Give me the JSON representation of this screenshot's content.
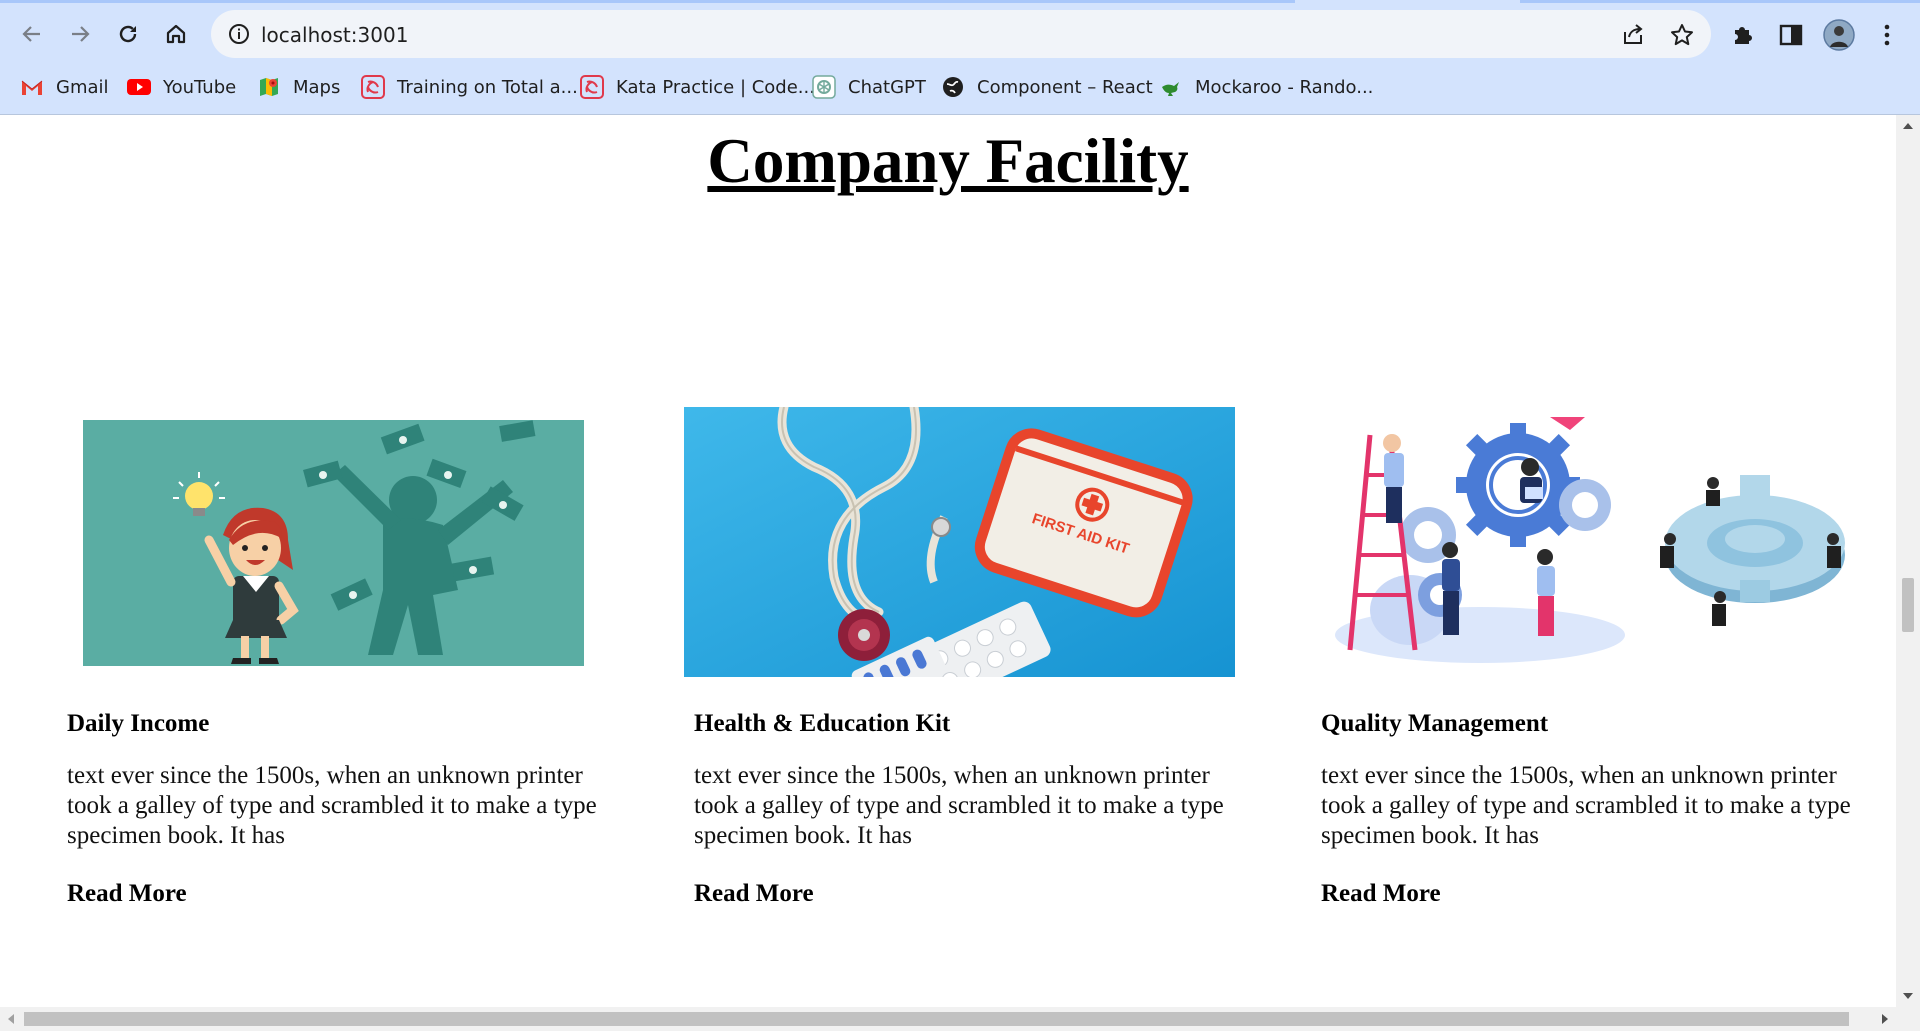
{
  "browser": {
    "url": "localhost:3001",
    "bookmarks": [
      {
        "label": "Gmail",
        "icon": "gmail-icon"
      },
      {
        "label": "YouTube",
        "icon": "youtube-icon"
      },
      {
        "label": "Maps",
        "icon": "maps-icon"
      },
      {
        "label": "Training on Total a...",
        "icon": "swirl-icon"
      },
      {
        "label": "Kata Practice | Code...",
        "icon": "swirl-icon"
      },
      {
        "label": "ChatGPT",
        "icon": "chatgpt-icon"
      },
      {
        "label": "Component – React",
        "icon": "globe-icon"
      },
      {
        "label": "Mockaroo - Rando...",
        "icon": "kangaroo-icon"
      }
    ]
  },
  "page": {
    "title": "Company Facility",
    "cards": [
      {
        "title": "Daily Income",
        "text": "text ever since the 1500s, when an unknown printer took a galley of type and scrambled it to make a type specimen book. It has",
        "link": "Read More",
        "image": "daily-income-illustration"
      },
      {
        "title": "Health & Education Kit",
        "text": "text ever since the 1500s, when an unknown printer took a galley of type and scrambled it to make a type specimen book. It has",
        "link": "Read More",
        "image": "first-aid-kit-photo",
        "image_caption": "FIRST AID KIT"
      },
      {
        "title": "Quality Management",
        "text": "text ever since the 1500s, when an unknown printer took a galley of type and scrambled it to make a type specimen book. It has",
        "link": "Read More",
        "image": "gears-team-illustration"
      }
    ]
  },
  "colors": {
    "chrome": "#d3e3fd",
    "omnibox": "#f1f4f9",
    "teal": "#5aada3",
    "blue": "#27a9e1"
  }
}
